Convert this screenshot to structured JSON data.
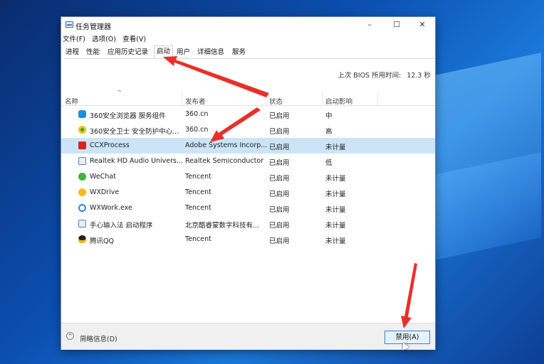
{
  "window": {
    "title": "任务管理器",
    "controls": {
      "minimize": "–",
      "maximize": "☐",
      "close": "✕"
    }
  },
  "menu": [
    "文件(F)",
    "选项(O)",
    "查看(V)"
  ],
  "tabs": [
    "进程",
    "性能",
    "应用历史记录",
    "启动",
    "用户",
    "详细信息",
    "服务"
  ],
  "active_tab": "启动",
  "bios": {
    "label": "上次 BIOS 所用时间:",
    "value": "12.3 秒"
  },
  "columns": {
    "name": "名称",
    "publisher": "发布者",
    "status": "状态",
    "impact": "启动影响"
  },
  "rows": [
    {
      "name": "360安全浏览器 服务组件",
      "publisher": "360.cn",
      "status": "已启用",
      "impact": "中"
    },
    {
      "name": "360安全卫士 安全防护中心...",
      "publisher": "360.cn",
      "status": "已启用",
      "impact": "高"
    },
    {
      "name": "CCXProcess",
      "publisher": "Adobe Systems Incorp...",
      "status": "已启用",
      "impact": "未计量"
    },
    {
      "name": "Realtek HD Audio Univers...",
      "publisher": "Realtek Semiconductor",
      "status": "已启用",
      "impact": "低"
    },
    {
      "name": "WeChat",
      "publisher": "Tencent",
      "status": "已启用",
      "impact": "未计量"
    },
    {
      "name": "WXDrive",
      "publisher": "Tencent",
      "status": "已启用",
      "impact": "未计量"
    },
    {
      "name": "WXWork.exe",
      "publisher": "Tencent",
      "status": "已启用",
      "impact": "未计量"
    },
    {
      "name": "手心输入法 启动程序",
      "publisher": "北京酷睿蒙数字科技有...",
      "status": "已启用",
      "impact": "未计量"
    },
    {
      "name": "腾讯QQ",
      "publisher": "Tencent",
      "status": "已启用",
      "impact": "未计量"
    }
  ],
  "selected_row": "CCXProcess",
  "footer": {
    "brief": "简略信息(D)",
    "disable": "禁用(A)"
  },
  "colors": {
    "accent": "#e8302a",
    "selection": "#cce4f7",
    "button_border": "#3c7fd4"
  },
  "icons": [
    "360-browser-icon",
    "360-security-icon",
    "ccx-icon",
    "realtek-icon",
    "wechat-icon",
    "wxdrive-icon",
    "wxwork-icon",
    "input-method-icon",
    "qq-icon"
  ]
}
